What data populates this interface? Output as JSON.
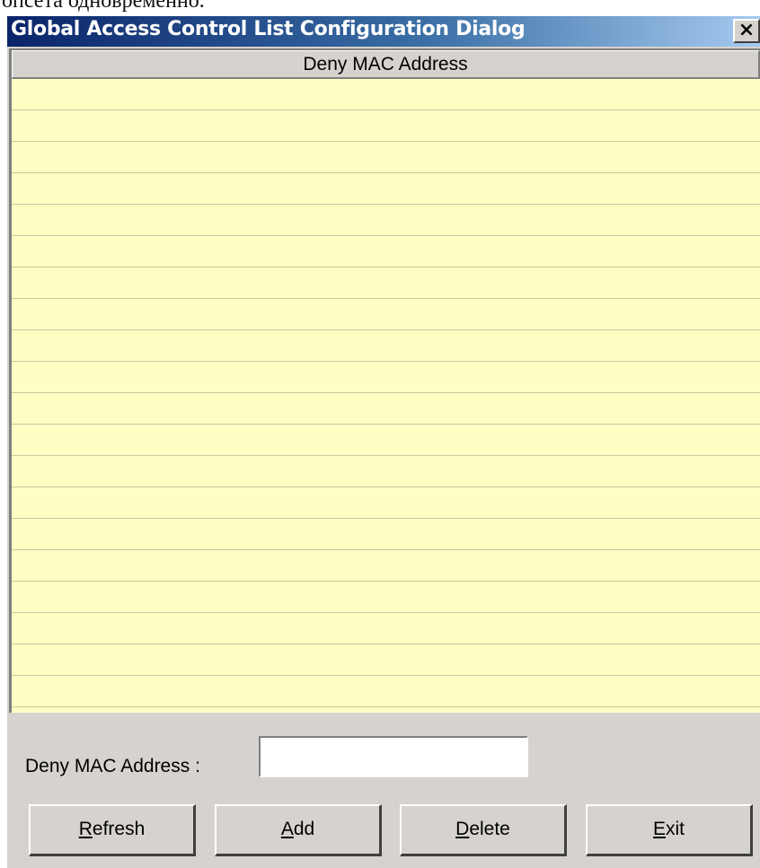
{
  "page_text": "опсета одновременно.",
  "dialog": {
    "title": "Global Access Control List Configuration Dialog",
    "close_glyph": "×"
  },
  "table": {
    "header": "Deny MAC Address",
    "rows": []
  },
  "form": {
    "label": "Deny MAC Address :",
    "value": ""
  },
  "buttons": {
    "refresh": {
      "mnemonic": "R",
      "rest": "efresh"
    },
    "add": {
      "mnemonic": "A",
      "rest": "dd"
    },
    "delete": {
      "mnemonic": "D",
      "rest": "elete"
    },
    "exit": {
      "mnemonic": "E",
      "rest": "xit"
    }
  },
  "colors": {
    "title_gradient_start": "#0a246a",
    "title_gradient_end": "#a6caf0",
    "list_background": "#ffffc4",
    "dialog_background": "#d6d3ce"
  }
}
